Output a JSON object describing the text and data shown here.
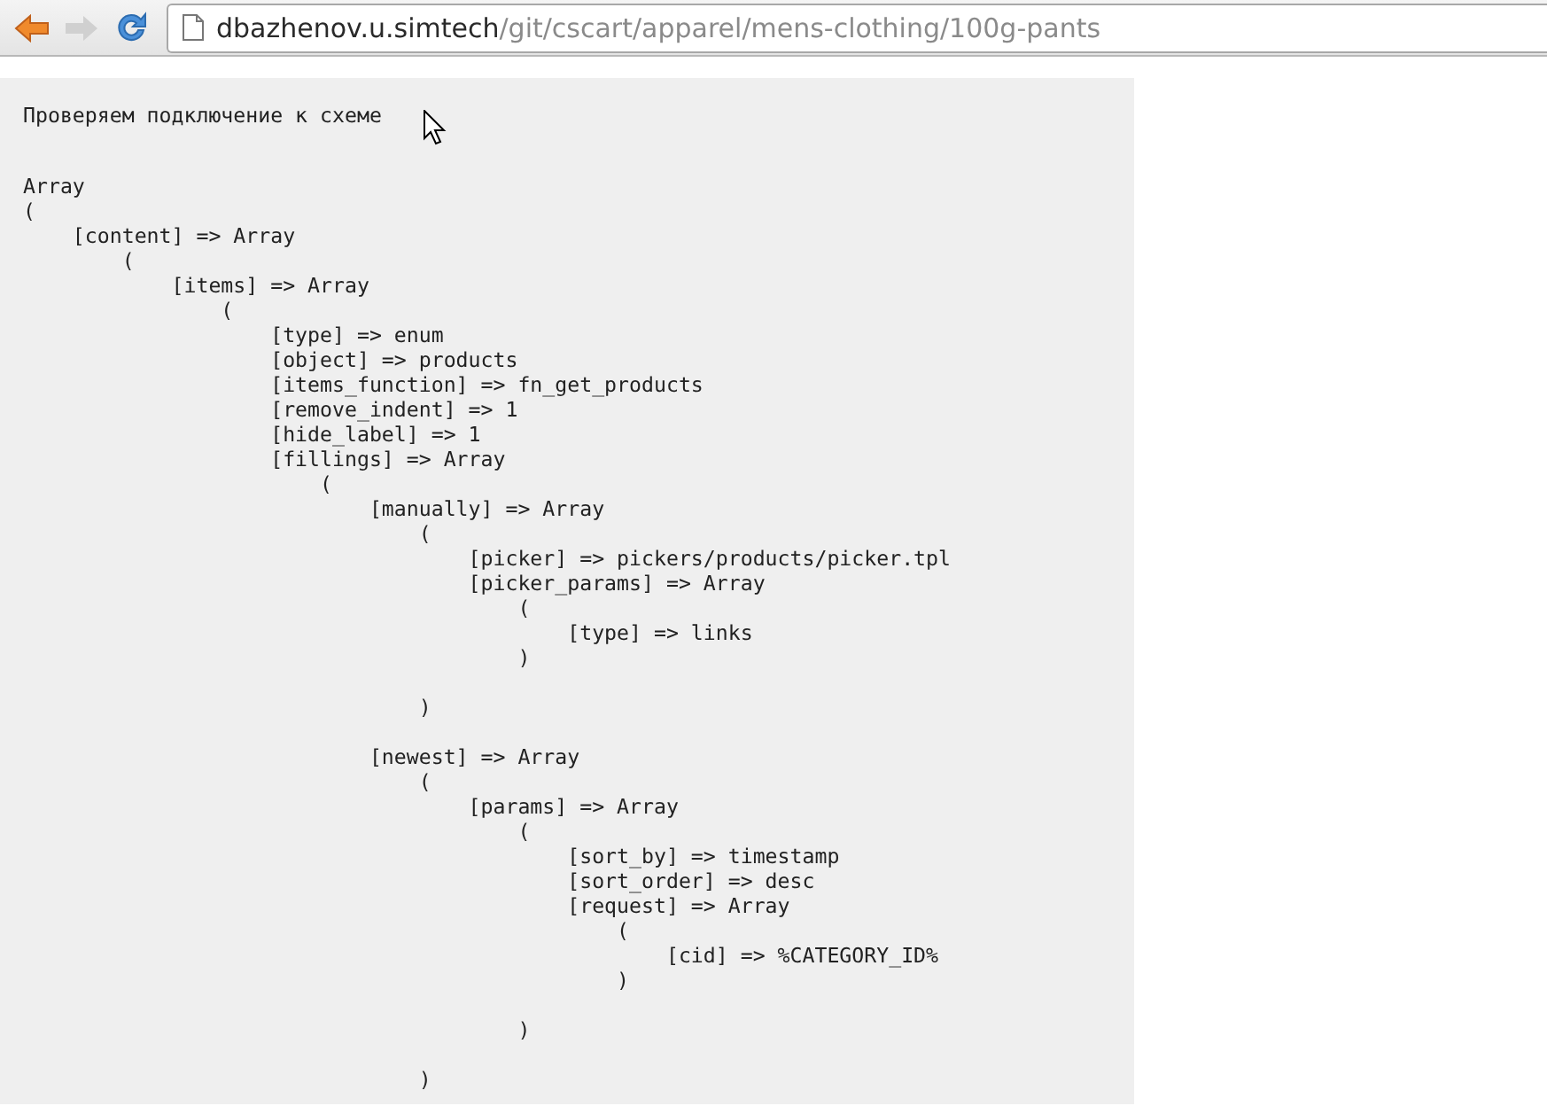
{
  "toolbar": {
    "back_enabled": true,
    "forward_enabled": false,
    "url_host": "dbazhenov.u.simtech",
    "url_path": "/git/cscart/apparel/mens-clothing/100g-pants"
  },
  "page": {
    "heading": "Проверяем подключение к схеме",
    "output": "Array\n(\n    [content] => Array\n        (\n            [items] => Array\n                (\n                    [type] => enum\n                    [object] => products\n                    [items_function] => fn_get_products\n                    [remove_indent] => 1\n                    [hide_label] => 1\n                    [fillings] => Array\n                        (\n                            [manually] => Array\n                                (\n                                    [picker] => pickers/products/picker.tpl\n                                    [picker_params] => Array\n                                        (\n                                            [type] => links\n                                        )\n\n                                )\n\n                            [newest] => Array\n                                (\n                                    [params] => Array\n                                        (\n                                            [sort_by] => timestamp\n                                            [sort_order] => desc\n                                            [request] => Array\n                                                (\n                                                    [cid] => %CATEGORY_ID%\n                                                )\n\n                                        )\n\n                                )"
  }
}
